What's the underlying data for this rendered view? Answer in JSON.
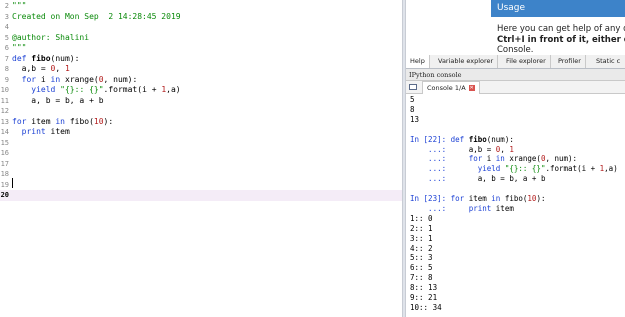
{
  "editor": {
    "lines": [
      {
        "n": "2",
        "parts": [
          {
            "t": "\"\"\"",
            "c": "c-str"
          }
        ]
      },
      {
        "n": "3",
        "parts": [
          {
            "t": "Created on Mon Sep  2 14:28:45 2019",
            "c": "c-str"
          }
        ]
      },
      {
        "n": "4",
        "parts": []
      },
      {
        "n": "5",
        "parts": [
          {
            "t": "@author: Shalini",
            "c": "c-str"
          }
        ]
      },
      {
        "n": "6",
        "parts": [
          {
            "t": "\"\"\"",
            "c": "c-str"
          }
        ]
      },
      {
        "n": "7",
        "parts": [
          {
            "t": "def ",
            "c": "c-kw"
          },
          {
            "t": "fibo",
            "c": "c-def"
          },
          {
            "t": "(num):",
            "c": "c-plain"
          }
        ]
      },
      {
        "n": "8",
        "parts": [
          {
            "t": "  a,b = ",
            "c": "c-plain"
          },
          {
            "t": "0",
            "c": "c-num"
          },
          {
            "t": ", ",
            "c": "c-plain"
          },
          {
            "t": "1",
            "c": "c-num"
          }
        ]
      },
      {
        "n": "9",
        "parts": [
          {
            "t": "  for ",
            "c": "c-kw"
          },
          {
            "t": "i ",
            "c": "c-plain"
          },
          {
            "t": "in ",
            "c": "c-kw"
          },
          {
            "t": "xrange(",
            "c": "c-plain"
          },
          {
            "t": "0",
            "c": "c-num"
          },
          {
            "t": ", num):",
            "c": "c-plain"
          }
        ]
      },
      {
        "n": "10",
        "parts": [
          {
            "t": "    yield ",
            "c": "c-kw"
          },
          {
            "t": "\"{}:: {}\"",
            "c": "c-str"
          },
          {
            "t": ".format(i + ",
            "c": "c-plain"
          },
          {
            "t": "1",
            "c": "c-num"
          },
          {
            "t": ",a)",
            "c": "c-plain"
          }
        ]
      },
      {
        "n": "11",
        "parts": [
          {
            "t": "    a, b = b, a + b",
            "c": "c-plain"
          }
        ]
      },
      {
        "n": "12",
        "parts": []
      },
      {
        "n": "13",
        "parts": [
          {
            "t": "for ",
            "c": "c-kw"
          },
          {
            "t": "item ",
            "c": "c-plain"
          },
          {
            "t": "in ",
            "c": "c-kw"
          },
          {
            "t": "fibo(",
            "c": "c-plain"
          },
          {
            "t": "10",
            "c": "c-num"
          },
          {
            "t": "):",
            "c": "c-plain"
          }
        ]
      },
      {
        "n": "14",
        "parts": [
          {
            "t": "  print ",
            "c": "c-kw"
          },
          {
            "t": "item",
            "c": "c-plain"
          }
        ]
      },
      {
        "n": "15",
        "parts": []
      },
      {
        "n": "16",
        "parts": []
      },
      {
        "n": "17",
        "parts": []
      },
      {
        "n": "18",
        "parts": []
      },
      {
        "n": "19",
        "parts": []
      },
      {
        "n": "20",
        "parts": [],
        "current": true
      }
    ]
  },
  "help": {
    "usage_title": "Usage",
    "line1": "Here you can get help of any obj",
    "line2": "Ctrl+I in front of it, either on th",
    "line3": "Console."
  },
  "help_tabs": [
    "Help",
    "Variable explorer",
    "File explorer",
    "Profiler",
    "Static c"
  ],
  "ipython": {
    "title": "IPython console",
    "tab_label": "Console 1/A",
    "close_glyph": "✕"
  },
  "console": {
    "lines": [
      {
        "parts": [
          {
            "t": "5",
            "c": ""
          }
        ]
      },
      {
        "parts": [
          {
            "t": "8",
            "c": ""
          }
        ]
      },
      {
        "parts": [
          {
            "t": "13",
            "c": ""
          }
        ]
      },
      {
        "parts": []
      },
      {
        "parts": [
          {
            "t": "In [22]: ",
            "c": "c-prompt"
          },
          {
            "t": "def ",
            "c": "c-kw"
          },
          {
            "t": "fibo",
            "c": "c-def"
          },
          {
            "t": "(num):",
            "c": ""
          }
        ]
      },
      {
        "parts": [
          {
            "t": "    ...:     ",
            "c": "c-cont"
          },
          {
            "t": "a,b = ",
            "c": ""
          },
          {
            "t": "0",
            "c": "c-num"
          },
          {
            "t": ", ",
            "c": ""
          },
          {
            "t": "1",
            "c": "c-num"
          }
        ]
      },
      {
        "parts": [
          {
            "t": "    ...:     ",
            "c": "c-cont"
          },
          {
            "t": "for ",
            "c": "c-kw"
          },
          {
            "t": "i ",
            "c": ""
          },
          {
            "t": "in ",
            "c": "c-kw"
          },
          {
            "t": "xrange(",
            "c": ""
          },
          {
            "t": "0",
            "c": "c-num"
          },
          {
            "t": ", num):",
            "c": ""
          }
        ]
      },
      {
        "parts": [
          {
            "t": "    ...:       ",
            "c": "c-cont"
          },
          {
            "t": "yield ",
            "c": "c-kw"
          },
          {
            "t": "\"{}:: {}\"",
            "c": "c-str"
          },
          {
            "t": ".format(i + ",
            "c": ""
          },
          {
            "t": "1",
            "c": "c-num"
          },
          {
            "t": ",a)",
            "c": ""
          }
        ]
      },
      {
        "parts": [
          {
            "t": "    ...:       ",
            "c": "c-cont"
          },
          {
            "t": "a, b = b, a + b",
            "c": ""
          }
        ]
      },
      {
        "parts": []
      },
      {
        "parts": [
          {
            "t": "In [23]: ",
            "c": "c-prompt"
          },
          {
            "t": "for ",
            "c": "c-kw"
          },
          {
            "t": "item ",
            "c": ""
          },
          {
            "t": "in ",
            "c": "c-kw"
          },
          {
            "t": "fibo(",
            "c": ""
          },
          {
            "t": "10",
            "c": "c-num"
          },
          {
            "t": "):",
            "c": ""
          }
        ]
      },
      {
        "parts": [
          {
            "t": "    ...:     ",
            "c": "c-cont"
          },
          {
            "t": "print ",
            "c": "c-kw"
          },
          {
            "t": "item",
            "c": ""
          }
        ]
      },
      {
        "parts": [
          {
            "t": "1:: 0",
            "c": ""
          }
        ]
      },
      {
        "parts": [
          {
            "t": "2:: 1",
            "c": ""
          }
        ]
      },
      {
        "parts": [
          {
            "t": "3:: 1",
            "c": ""
          }
        ]
      },
      {
        "parts": [
          {
            "t": "4:: 2",
            "c": ""
          }
        ]
      },
      {
        "parts": [
          {
            "t": "5:: 3",
            "c": ""
          }
        ]
      },
      {
        "parts": [
          {
            "t": "6:: 5",
            "c": ""
          }
        ]
      },
      {
        "parts": [
          {
            "t": "7:: 8",
            "c": ""
          }
        ]
      },
      {
        "parts": [
          {
            "t": "8:: 13",
            "c": ""
          }
        ]
      },
      {
        "parts": [
          {
            "t": "9:: 21",
            "c": ""
          }
        ]
      },
      {
        "parts": [
          {
            "t": "10:: 34",
            "c": ""
          }
        ]
      }
    ]
  }
}
